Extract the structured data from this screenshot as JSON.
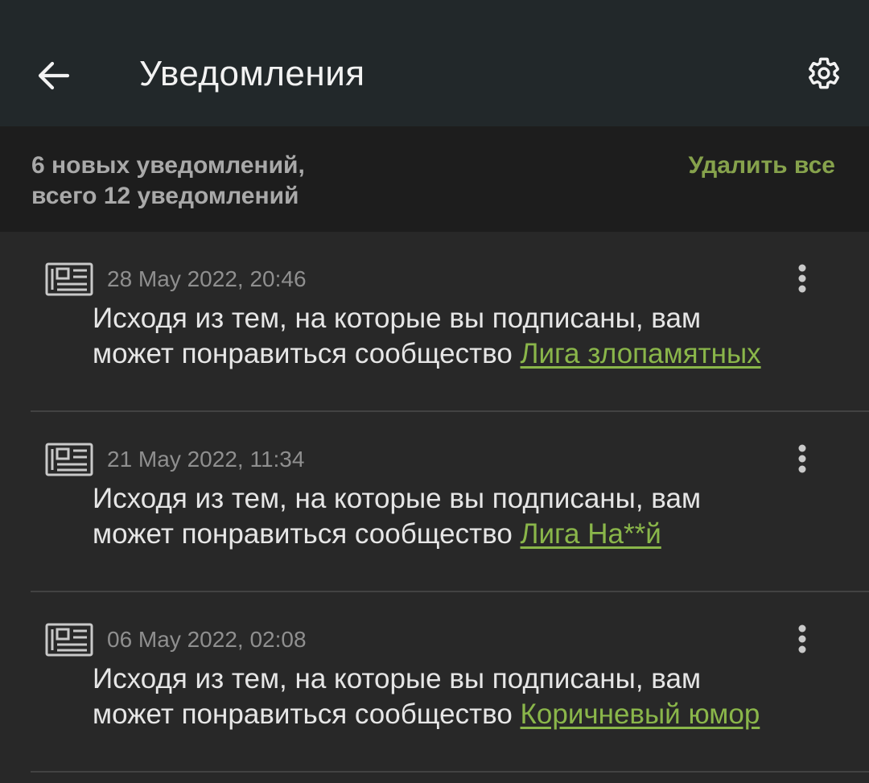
{
  "appbar": {
    "title": "Уведомления",
    "back_icon": "arrow-left-icon",
    "settings_icon": "gear-icon"
  },
  "summary": {
    "line1": "6 новых уведомлений,",
    "line2": "всего 12 уведомлений",
    "delete_all_label": "Удалить все"
  },
  "notifications": [
    {
      "icon": "newspaper-icon",
      "date": "28 May 2022, 20:46",
      "text_line1": "Исходя из тем, на которые вы подписаны, вам",
      "text_prefix": "может понравиться сообщество ",
      "link": "Лига злопамятных"
    },
    {
      "icon": "newspaper-icon",
      "date": "21 May 2022, 11:34",
      "text_line1": "Исходя из тем, на которые вы подписаны, вам",
      "text_prefix": "может понравиться сообщество ",
      "link": "Лига На**й"
    },
    {
      "icon": "newspaper-icon",
      "date": "06 May 2022, 02:08",
      "text_line1": "Исходя из тем, на которые вы подписаны, вам",
      "text_prefix": "может понравиться сообщество ",
      "link": "Коричневый юмор"
    }
  ],
  "colors": {
    "appbar_bg": "#22282a",
    "summary_bg": "#1d1d1d",
    "list_bg": "#282828",
    "accent": "#86a24c",
    "link": "#8ab64a"
  }
}
